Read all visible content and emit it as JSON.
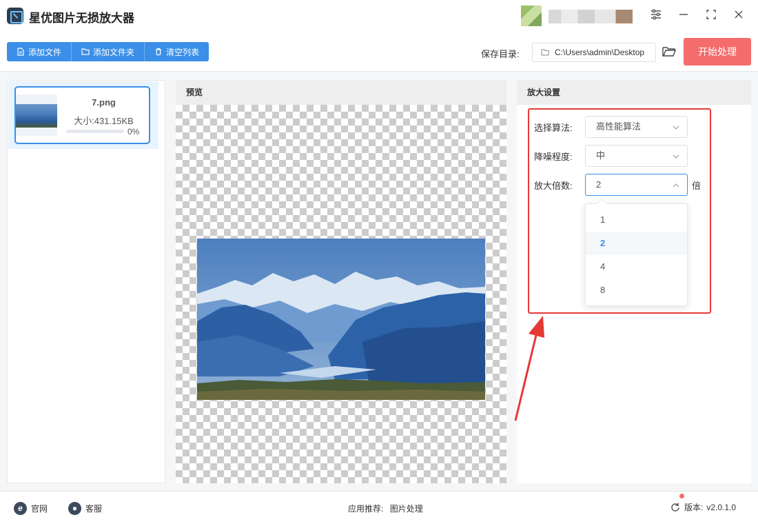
{
  "app": {
    "title": "星优图片无损放大器"
  },
  "window_controls": [
    "settings-sliders",
    "minimize",
    "maximize",
    "close"
  ],
  "toolbar": {
    "add_file": "添加文件",
    "add_folder": "添加文件夹",
    "clear_list": "清空列表",
    "save_dir_label": "保存目录:",
    "save_dir_value": "C:\\Users\\admin\\Desktop",
    "start_button": "开始处理"
  },
  "file_list": [
    {
      "name": "7.png",
      "size": "大小:431.15KB",
      "progress": 0,
      "progress_text": "0%"
    }
  ],
  "preview": {
    "title": "预览"
  },
  "settings": {
    "title": "放大设置",
    "algorithm_label": "选择算法:",
    "algorithm_value": "高性能算法",
    "denoise_label": "降噪程度:",
    "denoise_value": "中",
    "scale_label": "放大倍数:",
    "scale_value": "2",
    "scale_unit": "倍",
    "scale_options": [
      "1",
      "2",
      "4",
      "8"
    ],
    "scale_selected": "2"
  },
  "footer": {
    "website": "官网",
    "support": "客服",
    "recommend_label": "应用推荐:",
    "recommend_link": "图片处理",
    "version_label": "版本:",
    "version_value": "v2.0.1.0"
  },
  "colors": {
    "primary": "#3b8fe8",
    "start_button": "#f56c6c",
    "highlight_box": "#e53935"
  }
}
